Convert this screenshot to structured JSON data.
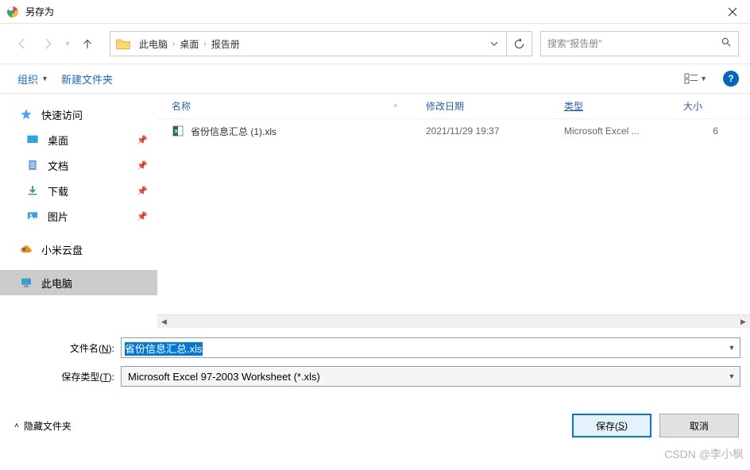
{
  "window": {
    "title": "另存为"
  },
  "breadcrumb": {
    "items": [
      "此电脑",
      "桌面",
      "报告册"
    ]
  },
  "search": {
    "placeholder": "搜索\"报告册\""
  },
  "toolbar": {
    "organize": "组织",
    "new_folder": "新建文件夹"
  },
  "sidebar": {
    "quick_access": "快速访问",
    "desktop": "桌面",
    "documents": "文档",
    "downloads": "下载",
    "pictures": "图片",
    "xiaomi": "小米云盘",
    "thispc": "此电脑"
  },
  "columns": {
    "name": "名称",
    "date": "修改日期",
    "type": "类型",
    "size": "大小"
  },
  "files": [
    {
      "name": "省份信息汇总 (1).xls",
      "date": "2021/11/29 19:37",
      "type": "Microsoft Excel ...",
      "size": "6"
    }
  ],
  "form": {
    "filename_label": "文件名(N):",
    "filename_value": "省份信息汇总.xls",
    "filetype_label": "保存类型(T):",
    "filetype_value": "Microsoft Excel 97-2003 Worksheet (*.xls)"
  },
  "bottom": {
    "hide_folders": "隐藏文件夹",
    "save": "保存(S)",
    "cancel": "取消"
  },
  "watermark": "CSDN @李小枫"
}
